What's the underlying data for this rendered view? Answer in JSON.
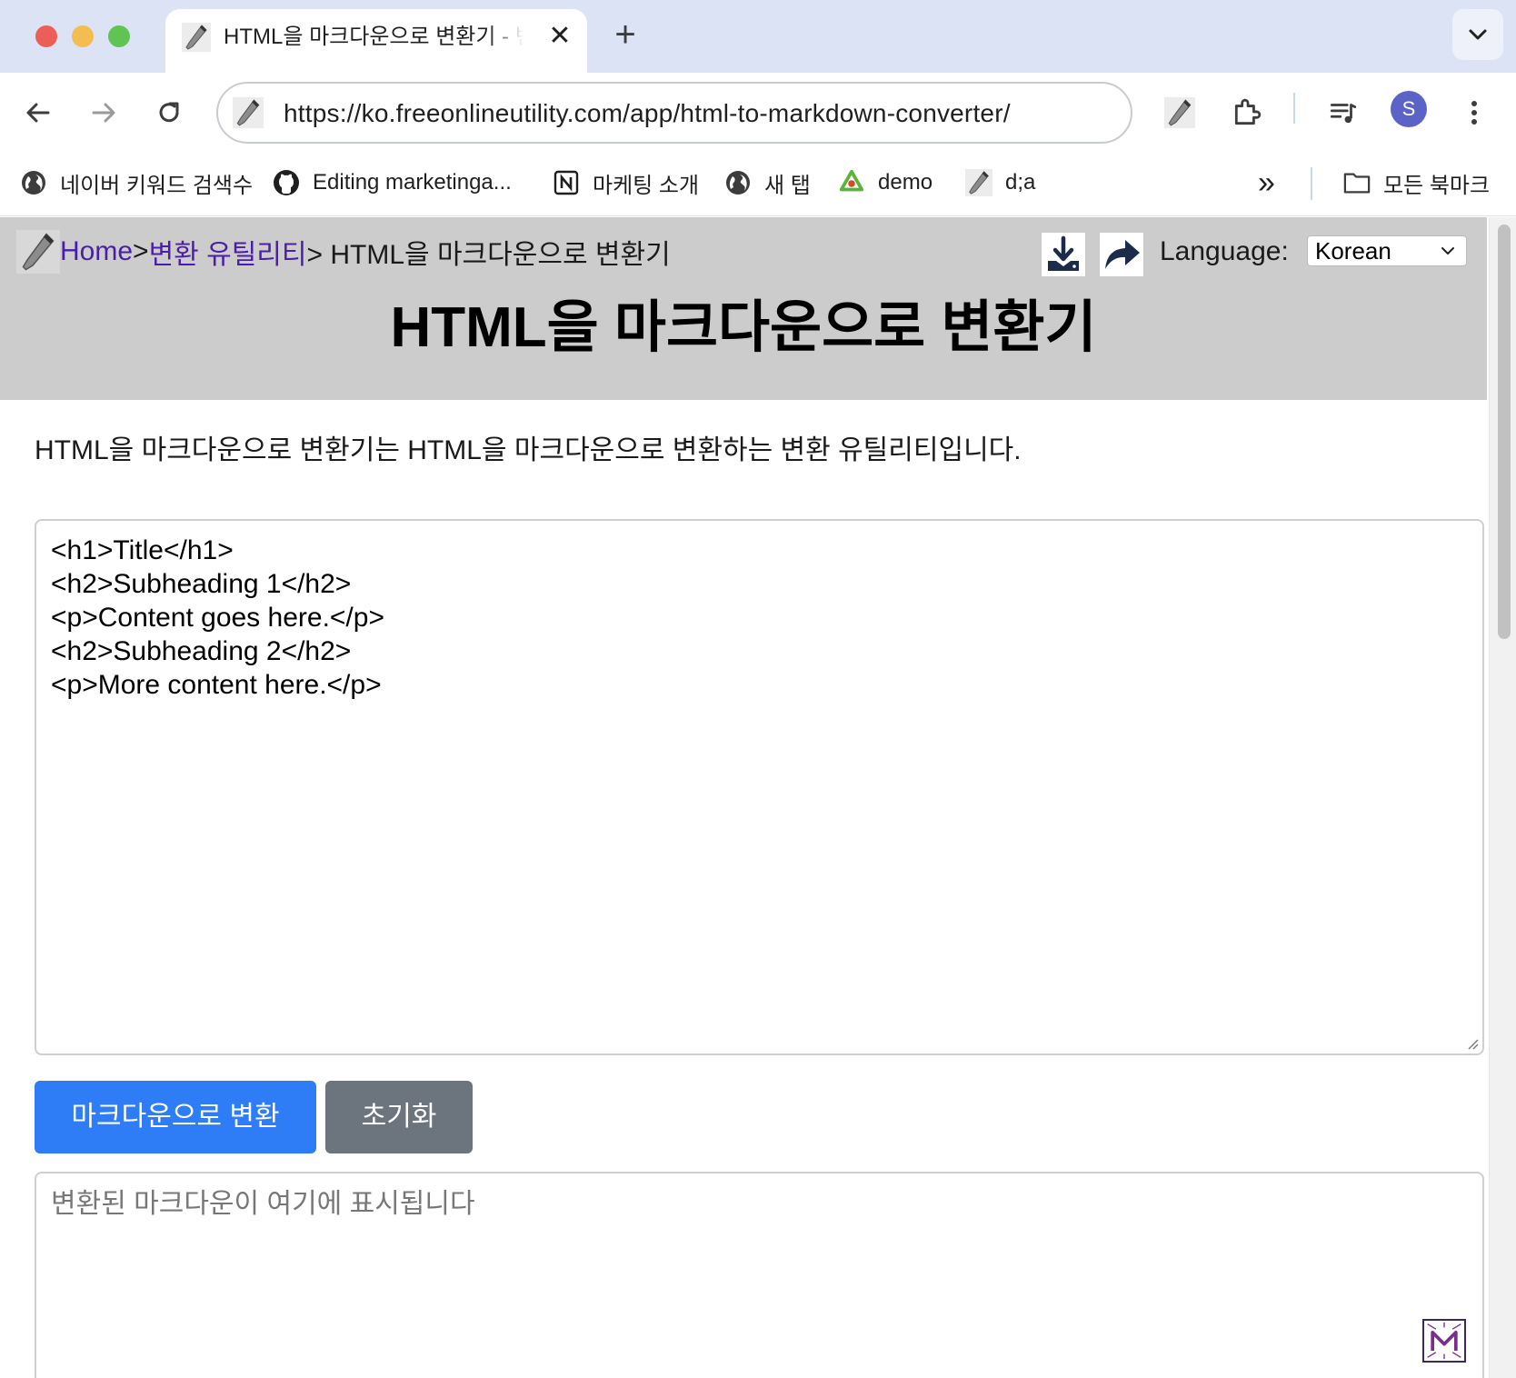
{
  "browser": {
    "tab": {
      "title": "HTML을 마크다운으로 변환기 - 변환 유틸리티",
      "close_glyph": "✕"
    },
    "new_tab_glyph": "+",
    "address": {
      "url": "https://ko.freeonlineutility.com/app/html-to-markdown-converter/"
    },
    "profile_initial": "S",
    "bookmarks": [
      {
        "label": "네이버 키워드 검색수",
        "icon": "globe-icon"
      },
      {
        "label": "Editing marketinga...",
        "icon": "github-icon"
      },
      {
        "label": "마케팅 소개",
        "icon": "notion-icon"
      },
      {
        "label": "새 탭",
        "icon": "globe-icon"
      },
      {
        "label": "demo",
        "icon": "recycle-icon"
      },
      {
        "label": "d;a",
        "icon": "wrench-icon"
      }
    ],
    "bookmarks_overflow_glyph": "»",
    "all_bookmarks_label": "모든 북마크"
  },
  "page": {
    "breadcrumb": {
      "home": "Home",
      "sep": ">",
      "category": "변환 유틸리티",
      "current": "> HTML을 마크다운으로 변환기"
    },
    "language": {
      "label": "Language:",
      "selected": "Korean"
    },
    "title": "HTML을 마크다운으로 변환기",
    "intro": "HTML을 마크다운으로 변환기는 HTML을 마크다운으로 변환하는 변환 유틸리티입니다.",
    "html_input_value": "<h1>Title</h1>\n<h2>Subheading 1</h2>\n<p>Content goes here.</p>\n<h2>Subheading 2</h2>\n<p>More content here.</p>",
    "convert_button": "마크다운으로 변환",
    "reset_button": "초기화",
    "output_placeholder": "변환된 마크다운이 여기에 표시됩니다"
  },
  "colors": {
    "tabstrip": "#dce3f5",
    "header_bg": "#cccccc",
    "link": "#4b1ea8",
    "primary_button": "#2e7cf6",
    "secondary_button": "#6c747d"
  }
}
